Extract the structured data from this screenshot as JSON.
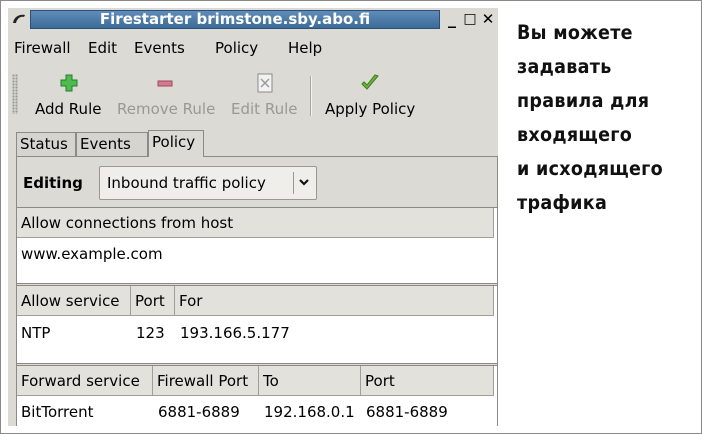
{
  "window": {
    "title": "Firestarter brimstone.sby.abo.fi",
    "controls": {
      "minimize": "_",
      "maximize": "□",
      "close": "✕"
    }
  },
  "menu": {
    "items": [
      "Firewall",
      "Edit",
      "Events",
      "Policy",
      "Help"
    ]
  },
  "toolbar": {
    "add_rule": "Add Rule",
    "remove_rule": "Remove Rule",
    "edit_rule": "Edit Rule",
    "apply_policy": "Apply Policy"
  },
  "tabs": [
    "Status",
    "Events",
    "Policy"
  ],
  "active_tab": "Policy",
  "policy": {
    "editing_label": "Editing",
    "selected_policy": "Inbound traffic policy"
  },
  "hosts_table": {
    "headers": [
      "Allow connections from host"
    ],
    "rows": [
      [
        "www.example.com"
      ]
    ]
  },
  "service_table": {
    "headers": [
      "Allow service",
      "Port",
      "For"
    ],
    "rows": [
      [
        "NTP",
        "123",
        "193.166.5.177"
      ]
    ]
  },
  "forward_table": {
    "headers": [
      "Forward service",
      "Firewall Port",
      "To",
      "Port"
    ],
    "rows": [
      [
        "BitTorrent",
        "6881-6889",
        "192.168.0.1",
        "6881-6889"
      ]
    ]
  },
  "caption": {
    "lines": [
      "Вы можете",
      "задавать",
      "правила для",
      "входящего",
      "и исходящего",
      "трафика"
    ]
  },
  "colors": {
    "title_bar": "#4a7aa9",
    "window_bg": "#dcdad5",
    "add_icon": "#3fae3f",
    "remove_icon": "#c85a72",
    "apply_icon": "#5aa02c"
  }
}
